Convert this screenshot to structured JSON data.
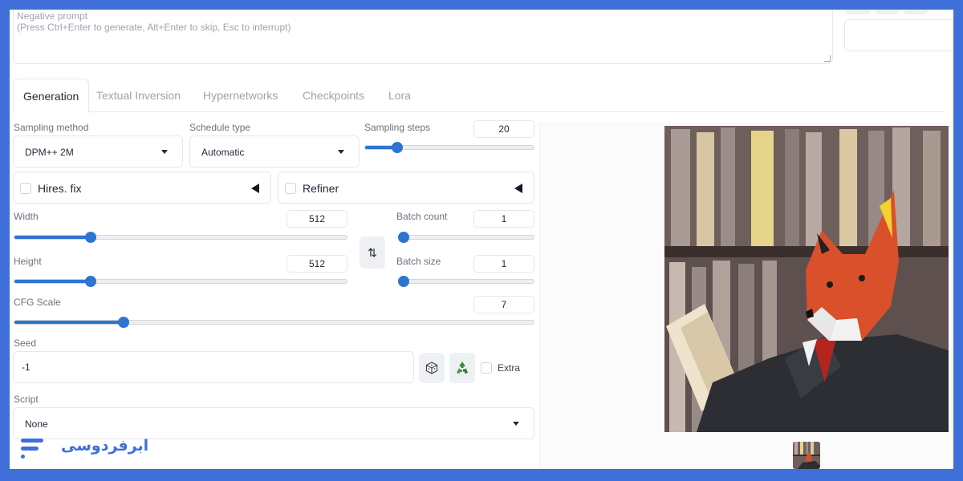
{
  "negative_prompt": {
    "label": "Negative prompt",
    "placeholder": "(Press Ctrl+Enter to generate, Alt+Enter to skip, Esc to interrupt)"
  },
  "tabs": [
    {
      "label": "Generation",
      "active": true
    },
    {
      "label": "Textual Inversion",
      "active": false
    },
    {
      "label": "Hypernetworks",
      "active": false
    },
    {
      "label": "Checkpoints",
      "active": false
    },
    {
      "label": "Lora",
      "active": false
    }
  ],
  "sampling_method": {
    "label": "Sampling method",
    "value": "DPM++ 2M"
  },
  "schedule_type": {
    "label": "Schedule type",
    "value": "Automatic"
  },
  "sampling_steps": {
    "label": "Sampling steps",
    "value": "20",
    "fraction": 0.19
  },
  "hires_fix": {
    "label": "Hires. fix",
    "checked": false
  },
  "refiner": {
    "label": "Refiner",
    "checked": false
  },
  "width": {
    "label": "Width",
    "value": "512",
    "fraction": 0.23
  },
  "height": {
    "label": "Height",
    "value": "512",
    "fraction": 0.23
  },
  "batch_count": {
    "label": "Batch count",
    "value": "1",
    "fraction": 0.0
  },
  "batch_size": {
    "label": "Batch size",
    "value": "1",
    "fraction": 0.0
  },
  "cfg_scale": {
    "label": "CFG Scale",
    "value": "7",
    "fraction": 0.21
  },
  "seed": {
    "label": "Seed",
    "value": "-1"
  },
  "extra": {
    "label": "Extra",
    "checked": false
  },
  "script": {
    "label": "Script",
    "value": "None"
  },
  "brand": {
    "logo_text": "ابرفردوسی",
    "color": "#3f6fd8"
  },
  "colors": {
    "accent": "#2f74d0",
    "frame": "#3f6fd8"
  }
}
